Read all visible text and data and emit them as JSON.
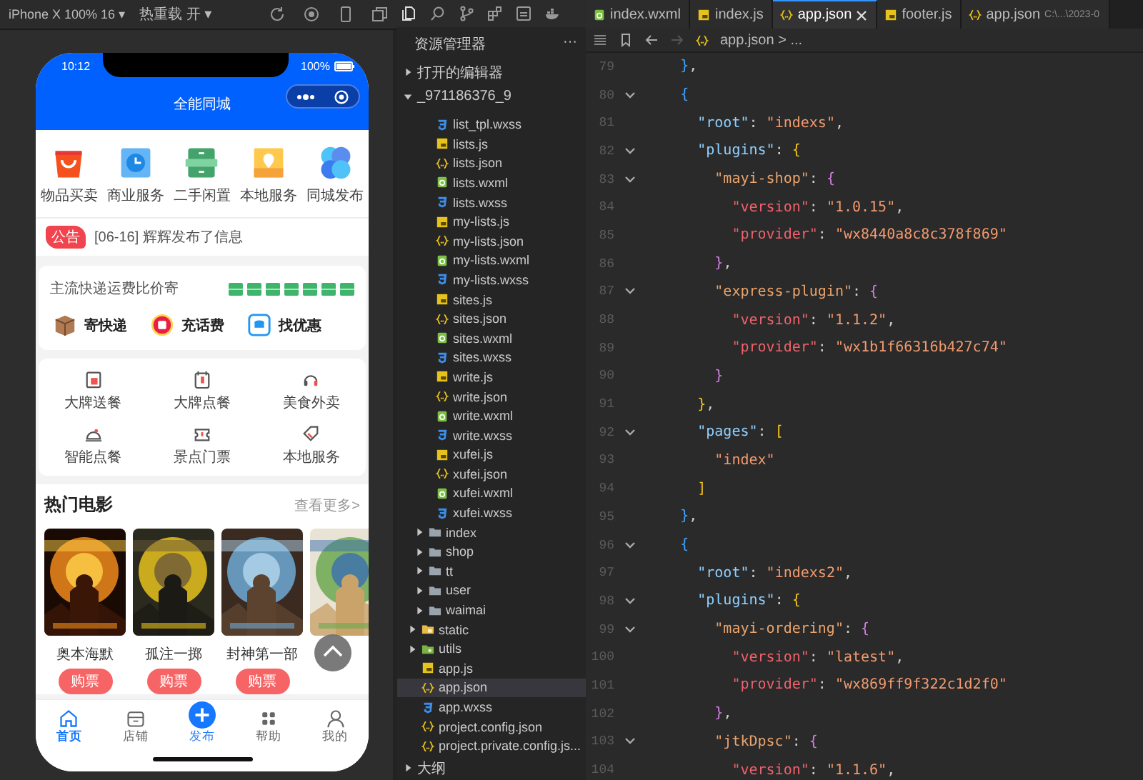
{
  "simulator": {
    "device": "iPhone X 100% 16 ▾",
    "hot_reload": "热重载 开 ▾"
  },
  "phone": {
    "time": "10:12",
    "battery": "100%",
    "title": "全能同城",
    "categories": [
      {
        "label": "物品买卖"
      },
      {
        "label": "商业服务"
      },
      {
        "label": "二手闲置"
      },
      {
        "label": "本地服务"
      },
      {
        "label": "同城发布"
      }
    ],
    "notice": {
      "badge": "公告",
      "text": "[06-16] 辉辉发布了信息"
    },
    "express": {
      "title": "主流快递运费比价寄",
      "actions": [
        {
          "label": "寄快递"
        },
        {
          "label": "充话费"
        },
        {
          "label": "找优惠"
        }
      ]
    },
    "services": [
      {
        "label": "大牌送餐"
      },
      {
        "label": "大牌点餐"
      },
      {
        "label": "美食外卖"
      },
      {
        "label": "智能点餐"
      },
      {
        "label": "景点门票"
      },
      {
        "label": "本地服务"
      }
    ],
    "movies": {
      "title": "热门电影",
      "more": "查看更多>",
      "items": [
        {
          "kind": "picture",
          "title": "奥本海默",
          "button": "购票"
        },
        {
          "kind": "picture",
          "title": "孤注一掷",
          "button": "购票"
        },
        {
          "kind": "picture",
          "title": "封神第一部",
          "button": "购票"
        },
        {
          "kind": "picture"
        }
      ]
    },
    "tabbar": [
      {
        "kind": "home",
        "label": "首页",
        "selected": true
      },
      {
        "kind": "shop",
        "label": "店铺",
        "selected": false
      },
      {
        "kind": "publish",
        "label": "发布",
        "selected": false
      },
      {
        "kind": "help",
        "label": "帮助",
        "selected": false
      },
      {
        "kind": "mine",
        "label": "我的",
        "selected": false
      }
    ]
  },
  "explorer": {
    "title": "资源管理器",
    "more": "···",
    "open_editors": {
      "label": "打开的编辑器",
      "expanded": false
    },
    "project": {
      "label": "_971186376_9",
      "expanded": true,
      "children": [
        {
          "children": [
            {
              "children": [
                {
                  "label": "list_tpl.wxss",
                  "kind": "css",
                  "selected": false
                },
                {
                  "label": "lists.js",
                  "kind": "js",
                  "selected": false
                },
                {
                  "label": "lists.json",
                  "kind": "json",
                  "selected": false
                },
                {
                  "label": "lists.wxml",
                  "kind": "wxml",
                  "selected": false
                },
                {
                  "label": "lists.wxss",
                  "kind": "css",
                  "selected": false
                },
                {
                  "label": "my-lists.js",
                  "kind": "js",
                  "selected": false
                },
                {
                  "label": "my-lists.json",
                  "kind": "json",
                  "selected": false
                },
                {
                  "label": "my-lists.wxml",
                  "kind": "wxml",
                  "selected": false
                },
                {
                  "label": "my-lists.wxss",
                  "kind": "css",
                  "selected": false
                },
                {
                  "label": "sites.js",
                  "kind": "js",
                  "selected": false
                },
                {
                  "label": "sites.json",
                  "kind": "json",
                  "selected": false
                },
                {
                  "label": "sites.wxml",
                  "kind": "wxml",
                  "selected": false
                },
                {
                  "label": "sites.wxss",
                  "kind": "css",
                  "selected": false
                },
                {
                  "label": "write.js",
                  "kind": "js",
                  "selected": false
                },
                {
                  "label": "write.json",
                  "kind": "json",
                  "selected": false
                },
                {
                  "label": "write.wxml",
                  "kind": "wxml",
                  "selected": false
                },
                {
                  "label": "write.wxss",
                  "kind": "css",
                  "selected": false
                },
                {
                  "label": "xufei.js",
                  "kind": "js",
                  "selected": false
                },
                {
                  "label": "xufei.json",
                  "kind": "json",
                  "selected": false
                },
                {
                  "label": "xufei.wxml",
                  "kind": "wxml",
                  "selected": false
                },
                {
                  "label": "xufei.wxss",
                  "kind": "css",
                  "selected": false
                }
              ]
            },
            {
              "label": "index",
              "kind": "folder",
              "expanded": false,
              "selected": false
            },
            {
              "label": "shop",
              "kind": "folder",
              "expanded": false,
              "selected": false
            },
            {
              "label": "tt",
              "kind": "folder",
              "expanded": false,
              "selected": false
            },
            {
              "label": "user",
              "kind": "folder",
              "expanded": false,
              "selected": false
            },
            {
              "label": "waimai",
              "kind": "folder",
              "expanded": false,
              "selected": false
            }
          ]
        },
        {
          "label": "static",
          "kind": "assets",
          "expanded": false,
          "selected": false
        },
        {
          "label": "utils",
          "kind": "utils",
          "expanded": false,
          "selected": false
        },
        {
          "label": "app.js",
          "kind": "js",
          "selected": false
        },
        {
          "label": "app.json",
          "kind": "json",
          "selected": true
        },
        {
          "label": "app.wxss",
          "kind": "css",
          "selected": false
        },
        {
          "label": "project.config.json",
          "kind": "json",
          "selected": false
        },
        {
          "label": "project.private.config.js...",
          "kind": "json",
          "selected": false
        }
      ]
    },
    "outline": {
      "label": "大纲",
      "expanded": false
    }
  },
  "tabs": [
    {
      "label": "index.wxml",
      "kind": "wxml",
      "selected": false
    },
    {
      "label": "index.js",
      "kind": "js",
      "selected": false
    },
    {
      "label": "app.json",
      "kind": "json",
      "selected": true
    },
    {
      "label": "footer.js",
      "kind": "js",
      "selected": false
    },
    {
      "label": "app.json",
      "path": "C:\\...\\2023-0",
      "kind": "json",
      "selected": false
    }
  ],
  "breadcrumb": "app.json > ...",
  "code": {
    "lines": [
      {
        "num": "79",
        "fold": false,
        "tokens": [
          {
            "kind": "blue",
            "text": "    }"
          },
          {
            "kind": "punct",
            "text": ","
          }
        ]
      },
      {
        "num": "80",
        "fold": true,
        "tokens": [
          {
            "kind": "blue",
            "text": "    {"
          }
        ]
      },
      {
        "num": "81",
        "fold": false,
        "tokens": [
          {
            "kind": "prop",
            "text": "      \"root\""
          },
          {
            "kind": "punct",
            "text": ": "
          },
          {
            "kind": "string",
            "text": "\"indexs\""
          },
          {
            "kind": "punct",
            "text": ","
          }
        ]
      },
      {
        "num": "82",
        "fold": true,
        "tokens": [
          {
            "kind": "prop",
            "text": "      \"plugins\""
          },
          {
            "kind": "punct",
            "text": ": "
          },
          {
            "kind": "gold",
            "text": "{"
          }
        ]
      },
      {
        "num": "83",
        "fold": true,
        "tokens": [
          {
            "kind": "plugin",
            "text": "        \"mayi-shop\""
          },
          {
            "kind": "punct",
            "text": ": "
          },
          {
            "kind": "purple",
            "text": "{"
          }
        ]
      },
      {
        "num": "84",
        "fold": false,
        "tokens": [
          {
            "kind": "field",
            "text": "          \"version\""
          },
          {
            "kind": "punct",
            "text": ": "
          },
          {
            "kind": "string",
            "text": "\"1.0.15\""
          },
          {
            "kind": "punct",
            "text": ","
          }
        ]
      },
      {
        "num": "85",
        "fold": false,
        "tokens": [
          {
            "kind": "field",
            "text": "          \"provider\""
          },
          {
            "kind": "punct",
            "text": ": "
          },
          {
            "kind": "string",
            "text": "\"wx8440a8c8c378f869\""
          }
        ]
      },
      {
        "num": "86",
        "fold": false,
        "tokens": [
          {
            "kind": "purple",
            "text": "        }"
          },
          {
            "kind": "punct",
            "text": ","
          }
        ]
      },
      {
        "num": "87",
        "fold": true,
        "tokens": [
          {
            "kind": "plugin",
            "text": "        \"express-plugin\""
          },
          {
            "kind": "punct",
            "text": ": "
          },
          {
            "kind": "purple",
            "text": "{"
          }
        ]
      },
      {
        "num": "88",
        "fold": false,
        "tokens": [
          {
            "kind": "field",
            "text": "          \"version\""
          },
          {
            "kind": "punct",
            "text": ": "
          },
          {
            "kind": "string",
            "text": "\"1.1.2\""
          },
          {
            "kind": "punct",
            "text": ","
          }
        ]
      },
      {
        "num": "89",
        "fold": false,
        "tokens": [
          {
            "kind": "field",
            "text": "          \"provider\""
          },
          {
            "kind": "punct",
            "text": ": "
          },
          {
            "kind": "string",
            "text": "\"wx1b1f66316b427c74\""
          }
        ]
      },
      {
        "num": "90",
        "fold": false,
        "tokens": [
          {
            "kind": "purple",
            "text": "        }"
          }
        ]
      },
      {
        "num": "91",
        "fold": false,
        "tokens": [
          {
            "kind": "gold",
            "text": "      }"
          },
          {
            "kind": "punct",
            "text": ","
          }
        ]
      },
      {
        "num": "92",
        "fold": true,
        "tokens": [
          {
            "kind": "prop",
            "text": "      \"pages\""
          },
          {
            "kind": "punct",
            "text": ": "
          },
          {
            "kind": "gold",
            "text": "["
          }
        ]
      },
      {
        "num": "93",
        "fold": false,
        "tokens": [
          {
            "kind": "string",
            "text": "        \"index\""
          }
        ]
      },
      {
        "num": "94",
        "fold": false,
        "tokens": [
          {
            "kind": "gold",
            "text": "      ]"
          }
        ]
      },
      {
        "num": "95",
        "fold": false,
        "tokens": [
          {
            "kind": "blue",
            "text": "    }"
          },
          {
            "kind": "punct",
            "text": ","
          }
        ]
      },
      {
        "num": "96",
        "fold": true,
        "tokens": [
          {
            "kind": "blue",
            "text": "    {"
          }
        ]
      },
      {
        "num": "97",
        "fold": false,
        "tokens": [
          {
            "kind": "prop",
            "text": "      \"root\""
          },
          {
            "kind": "punct",
            "text": ": "
          },
          {
            "kind": "string",
            "text": "\"indexs2\""
          },
          {
            "kind": "punct",
            "text": ","
          }
        ]
      },
      {
        "num": "98",
        "fold": true,
        "tokens": [
          {
            "kind": "prop",
            "text": "      \"plugins\""
          },
          {
            "kind": "punct",
            "text": ": "
          },
          {
            "kind": "gold",
            "text": "{"
          }
        ]
      },
      {
        "num": "99",
        "fold": true,
        "tokens": [
          {
            "kind": "plugin",
            "text": "        \"mayi-ordering\""
          },
          {
            "kind": "punct",
            "text": ": "
          },
          {
            "kind": "purple",
            "text": "{"
          }
        ]
      },
      {
        "num": "100",
        "fold": false,
        "tokens": [
          {
            "kind": "field",
            "text": "          \"version\""
          },
          {
            "kind": "punct",
            "text": ": "
          },
          {
            "kind": "string",
            "text": "\"latest\""
          },
          {
            "kind": "punct",
            "text": ","
          }
        ]
      },
      {
        "num": "101",
        "fold": false,
        "tokens": [
          {
            "kind": "field",
            "text": "          \"provider\""
          },
          {
            "kind": "punct",
            "text": ": "
          },
          {
            "kind": "string",
            "text": "\"wx869ff9f322c1d2f0\""
          }
        ]
      },
      {
        "num": "102",
        "fold": false,
        "tokens": [
          {
            "kind": "purple",
            "text": "        }"
          },
          {
            "kind": "punct",
            "text": ","
          }
        ]
      },
      {
        "num": "103",
        "fold": true,
        "tokens": [
          {
            "kind": "plugin",
            "text": "        \"jtkDpsc\""
          },
          {
            "kind": "punct",
            "text": ": "
          },
          {
            "kind": "purple",
            "text": "{"
          }
        ]
      },
      {
        "num": "104",
        "fold": false,
        "tokens": [
          {
            "kind": "field",
            "text": "          \"version\""
          },
          {
            "kind": "punct",
            "text": ": "
          },
          {
            "kind": "string",
            "text": "\"1.1.6\""
          },
          {
            "kind": "punct",
            "text": ","
          }
        ]
      }
    ]
  }
}
